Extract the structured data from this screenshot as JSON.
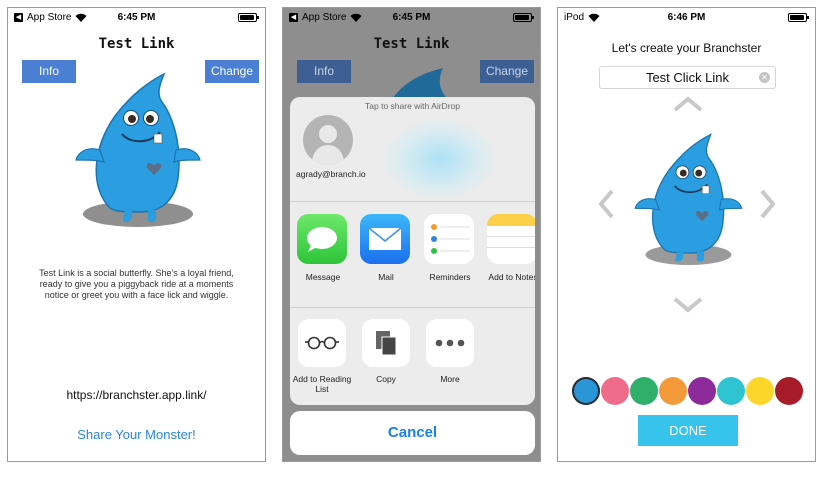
{
  "screen1": {
    "status": {
      "back_label": "App Store",
      "time": "6:45 PM"
    },
    "title": "Test Link",
    "info_button": "Info",
    "change_button": "Change",
    "description": "Test Link is a social butterfly. She's a loyal friend, ready to give you a piggyback ride at a moments notice or greet you with a face lick and wiggle.",
    "link_url": "https://branchster.app.link/",
    "share_label": "Share Your Monster!"
  },
  "screen2": {
    "status": {
      "back_label": "App Store",
      "time": "6:45 PM"
    },
    "title": "Test Link",
    "info_button": "Info",
    "change_button": "Change",
    "airdrop_hint": "Tap to share with AirDrop",
    "contact_name": "agrady@branch.io",
    "share_apps": [
      {
        "label": "Message",
        "icon": "message-icon"
      },
      {
        "label": "Mail",
        "icon": "mail-icon"
      },
      {
        "label": "Reminders",
        "icon": "reminders-icon"
      },
      {
        "label": "Add to Notes",
        "icon": "notes-icon"
      }
    ],
    "actions": [
      {
        "label": "Add to Reading List",
        "icon": "glasses-icon"
      },
      {
        "label": "Copy",
        "icon": "copy-icon"
      },
      {
        "label": "More",
        "icon": "more-icon"
      }
    ],
    "cancel_label": "Cancel"
  },
  "screen3": {
    "status": {
      "device": "iPod",
      "time": "6:46 PM"
    },
    "prompt": "Let's create your Branchster",
    "name_value": "Test Click Link",
    "done_label": "DONE",
    "colors": [
      "#2a96d8",
      "#f06a8a",
      "#2eaf6a",
      "#f39a3a",
      "#8c2a9a",
      "#2ec4d2",
      "#fcd62a",
      "#a81c2a"
    ],
    "selected_color": 0
  },
  "monster_color": "#2a9ee0"
}
